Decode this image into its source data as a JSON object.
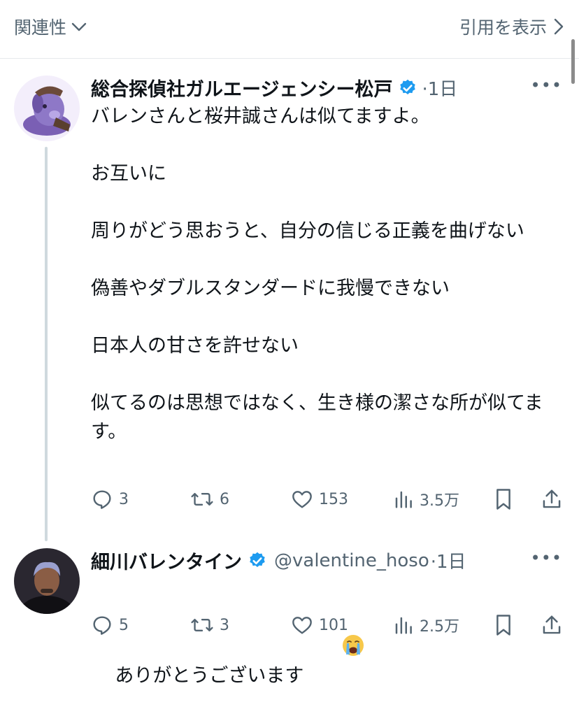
{
  "header": {
    "sort_label": "関連性",
    "quotes_label": "引用を表示"
  },
  "colors": {
    "verified": "#1d9bf0",
    "secondary_text": "#536471",
    "thread_line": "#cfd9de"
  },
  "posts": [
    {
      "display_name": "総合探偵社ガルエージェンシー松戸",
      "verified": true,
      "handle": "",
      "time": "·1日",
      "text": "バレンさんと桜井誠さんは似てますよ。\n\nお互いに\n\n周りがどう思おうと、自分の信じる正義を曲げない\n\n偽善やダブルスタンダードに我慢できない\n\n日本人の甘さを許せない\n\n似てるのは思想ではなく、生き様の潔さな所が似てます。",
      "stats": {
        "replies": "3",
        "reposts": "6",
        "likes": "153",
        "views": "3.5万"
      }
    },
    {
      "display_name": "細川バレンタイン",
      "verified": true,
      "handle": "@valentine_hoso",
      "time": "·1日",
      "text": "ありがとうございます",
      "emoji": "loudly-crying-face",
      "stats": {
        "replies": "5",
        "reposts": "3",
        "likes": "101",
        "views": "2.5万"
      }
    }
  ]
}
